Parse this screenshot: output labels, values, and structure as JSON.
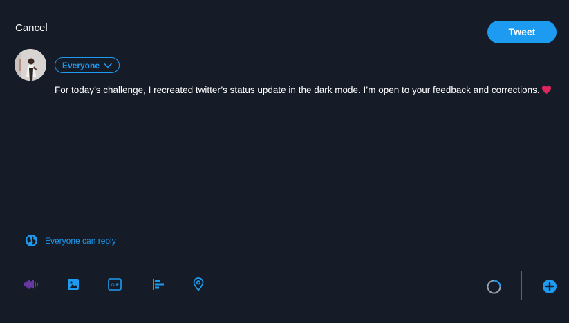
{
  "header": {
    "cancel_label": "Cancel",
    "tweet_label": "Tweet"
  },
  "composer": {
    "audience_label": "Everyone",
    "status_text": "For today’s challenge, I  recreated twitter’s status update in the dark mode. I’m open to your feedback and corrections."
  },
  "reply_setting": {
    "label": "Everyone can reply",
    "icon": "globe-icon"
  },
  "toolbar": {
    "tools": [
      "voice-audio-icon",
      "image-icon",
      "gif-icon",
      "poll-icon",
      "location-icon"
    ],
    "counter_icon": "character-counter-icon",
    "add_icon": "add-thread-icon"
  },
  "colors": {
    "background": "#151c27",
    "accent": "#1d9bf0",
    "heart": "#e0245e",
    "text": "#ffffff",
    "voice": "#7b3fbf"
  }
}
